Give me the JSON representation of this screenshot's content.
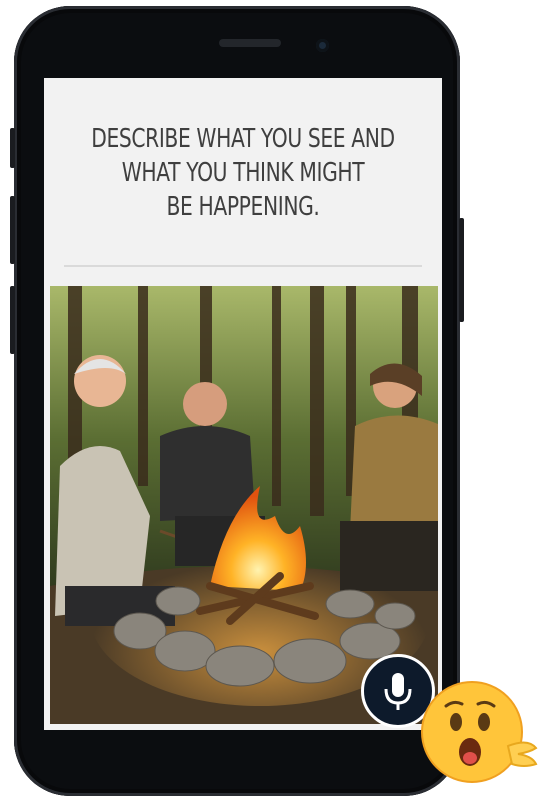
{
  "prompt": {
    "line1": "DESCRIBE WHAT YOU SEE AND",
    "line2": "WHAT YOU THINK MIGHT",
    "line3": "BE HAPPENING."
  },
  "icons": {
    "mic": "microphone-icon",
    "emoji": "surprised-face-emoji"
  },
  "colors": {
    "prompt_text": "#3f3f3f",
    "screen_bg": "#f2f2f2",
    "mic_button": "#0d1a2b",
    "phone_frame": "#0b0d10",
    "fire": "#ff9a1f",
    "emoji_face": "#ffc53a"
  }
}
